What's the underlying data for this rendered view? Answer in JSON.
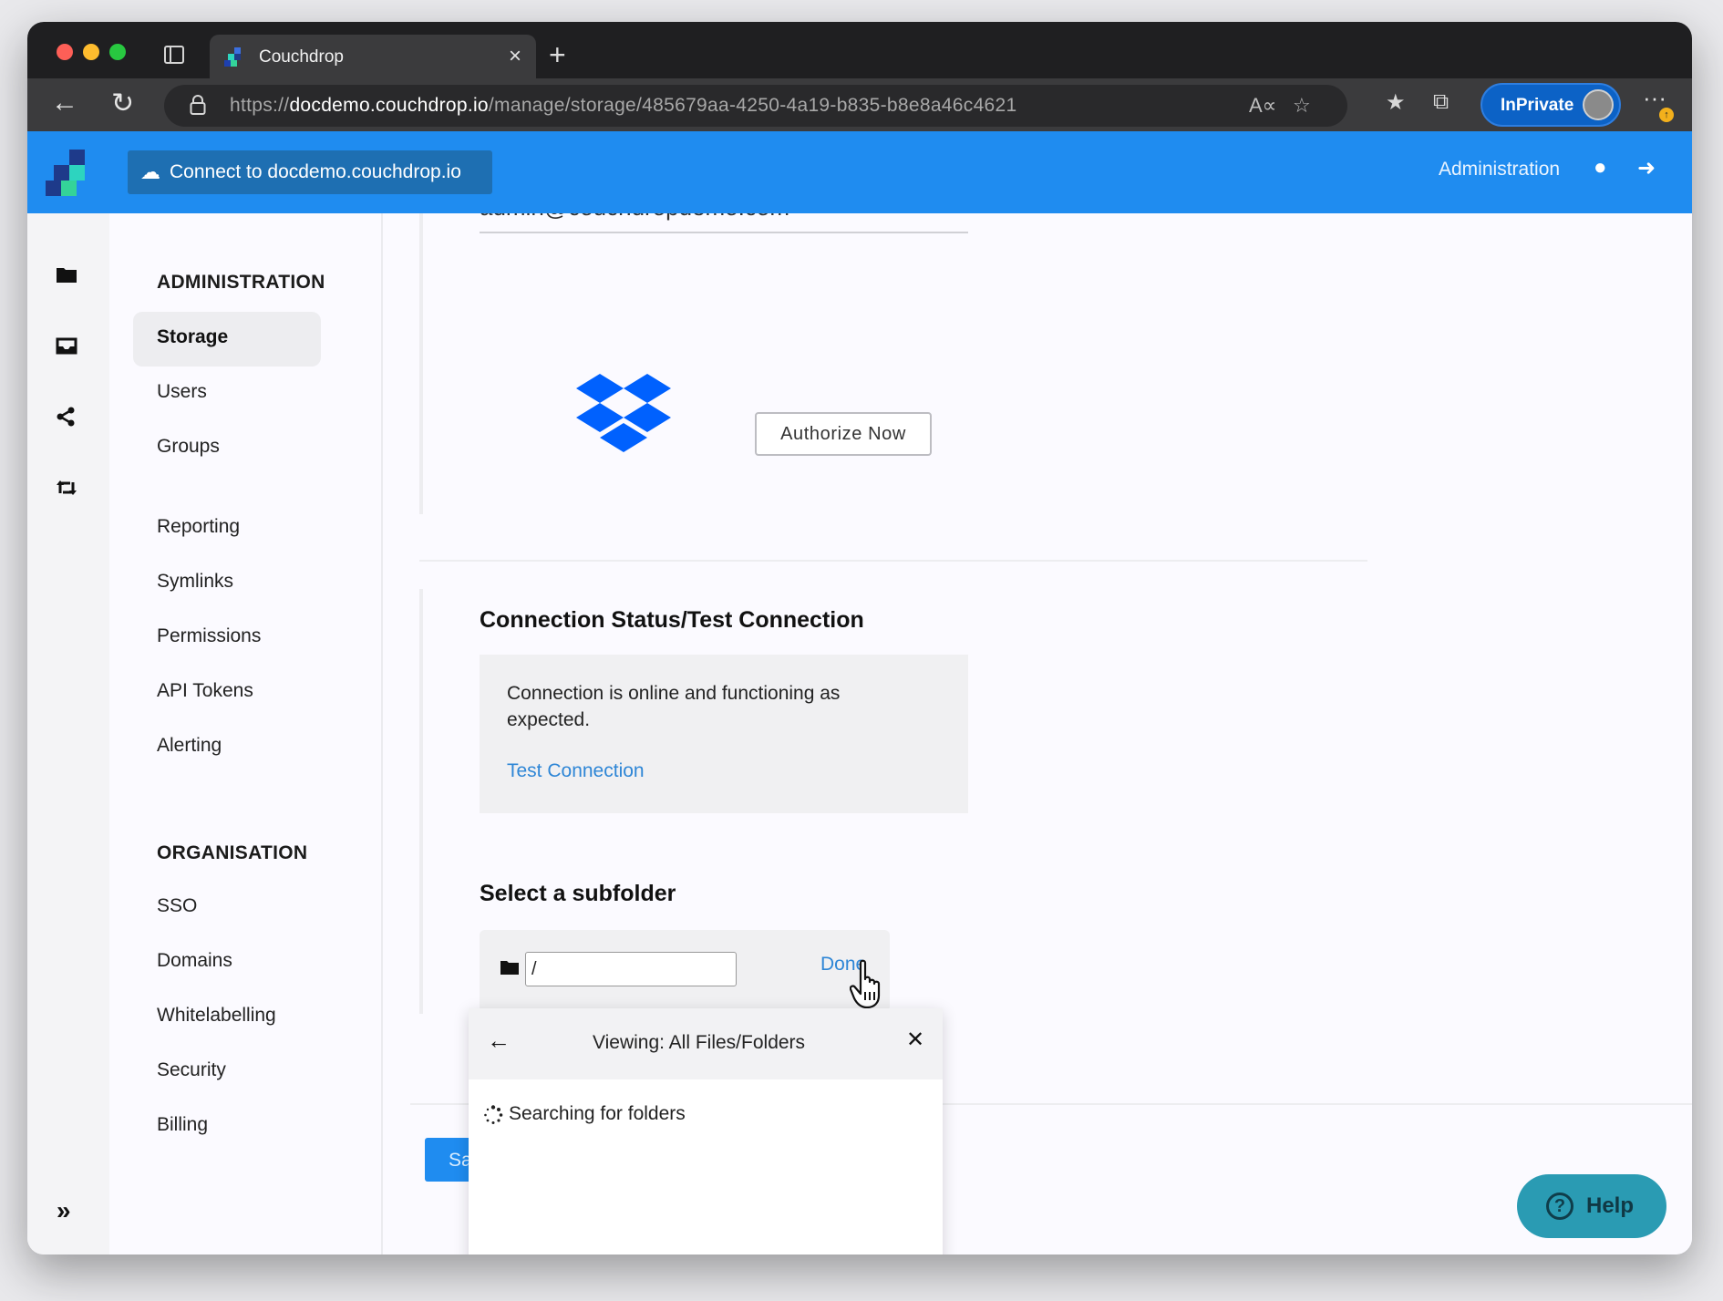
{
  "browser": {
    "tab_title": "Couchdrop",
    "tab_close": "×",
    "new_tab": "+",
    "url_scheme": "https://",
    "url_host": "docdemo.couchdrop.io",
    "url_path": "/manage/storage/485679aa-4250-4a19-b835-b8e8a46c4621",
    "inprivate_label": "InPrivate",
    "more": "···"
  },
  "header": {
    "connect_label": "Connect to docdemo.couchdrop.io",
    "admin_link": "Administration",
    "brand_color": "#1f8cf0"
  },
  "sidebar": {
    "admin_heading": "ADMINISTRATION",
    "admin_items": [
      "Storage",
      "Users",
      "Groups",
      "Reporting",
      "Symlinks",
      "Permissions",
      "API Tokens",
      "Alerting"
    ],
    "active_item": "Storage",
    "org_heading": "ORGANISATION",
    "org_items": [
      "SSO",
      "Domains",
      "Whitelabelling",
      "Security",
      "Billing"
    ]
  },
  "main": {
    "email_value": "admin@couchdropdemo.com",
    "authorize_label": "Authorize Now",
    "connection_title": "Connection Status/Test Connection",
    "connection_status": "Connection is online and functioning as expected.",
    "test_connection_label": "Test Connection",
    "subfolder_title": "Select a subfolder",
    "path_value": "/",
    "done_label": "Done",
    "save_label": "Sav"
  },
  "picker": {
    "title": "Viewing: All Files/Folders",
    "status": "Searching for folders"
  },
  "help": {
    "label": "Help"
  }
}
